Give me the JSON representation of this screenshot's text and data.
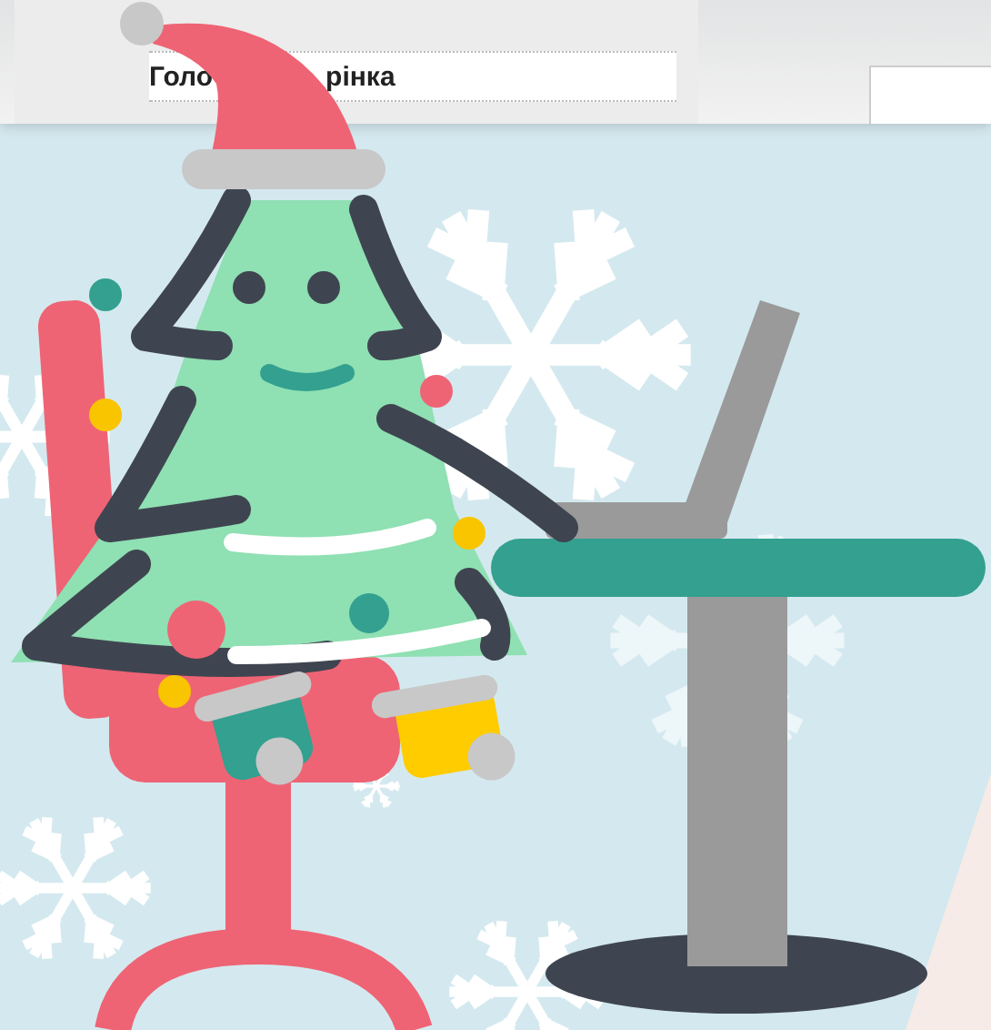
{
  "header": {
    "title_parts": [
      "Голо",
      "рінка"
    ]
  }
}
